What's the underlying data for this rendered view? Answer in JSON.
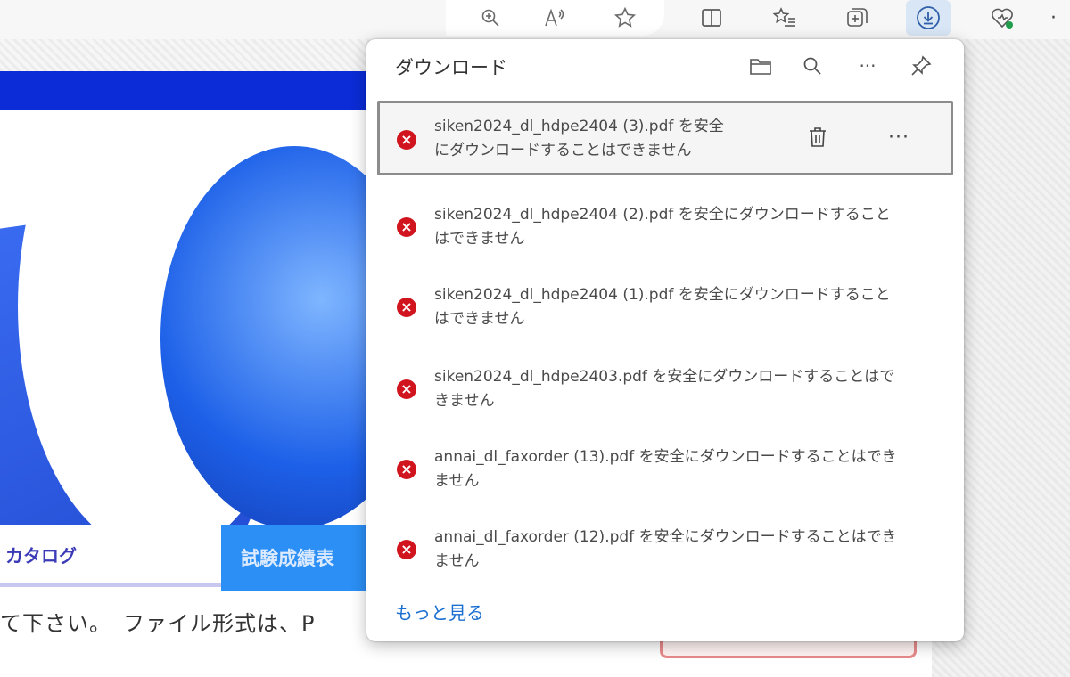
{
  "toolbar": {
    "icons": [
      "zoom-icon",
      "read-aloud-icon",
      "favorite-star-icon",
      "split-screen-icon",
      "favorites-list-icon",
      "collections-icon",
      "downloads-icon",
      "browser-essentials-icon",
      "more-icon"
    ]
  },
  "page": {
    "tab_catalog": "カタログ",
    "tab_results": "試験成績表",
    "body_text": "て下さい。　ファイル形式は、P"
  },
  "downloads_panel": {
    "title": "ダウンロード",
    "items": [
      {
        "text": "siken2024_dl_hdpe2404 (3).pdf を安全にダウンロードすることはできません",
        "selected": true
      },
      {
        "text": "siken2024_dl_hdpe2404 (2).pdf を安全にダウンロードすることはできません",
        "selected": false
      },
      {
        "text": "siken2024_dl_hdpe2404 (1).pdf を安全にダウンロードすることはできません",
        "selected": false
      },
      {
        "text": "siken2024_dl_hdpe2403.pdf を安全にダウンロードすることはできません",
        "selected": false
      },
      {
        "text": "annai_dl_faxorder (13).pdf を安全にダウンロードすることはできません",
        "selected": false
      },
      {
        "text": "annai_dl_faxorder (12).pdf を安全にダウンロードすることはできません",
        "selected": false
      }
    ],
    "see_more": "もっと見る",
    "item_more_label": "···"
  },
  "colors": {
    "error_red": "#d1151e",
    "link_blue": "#1a6fd1",
    "active_icon_bg": "#d9e6f5"
  }
}
